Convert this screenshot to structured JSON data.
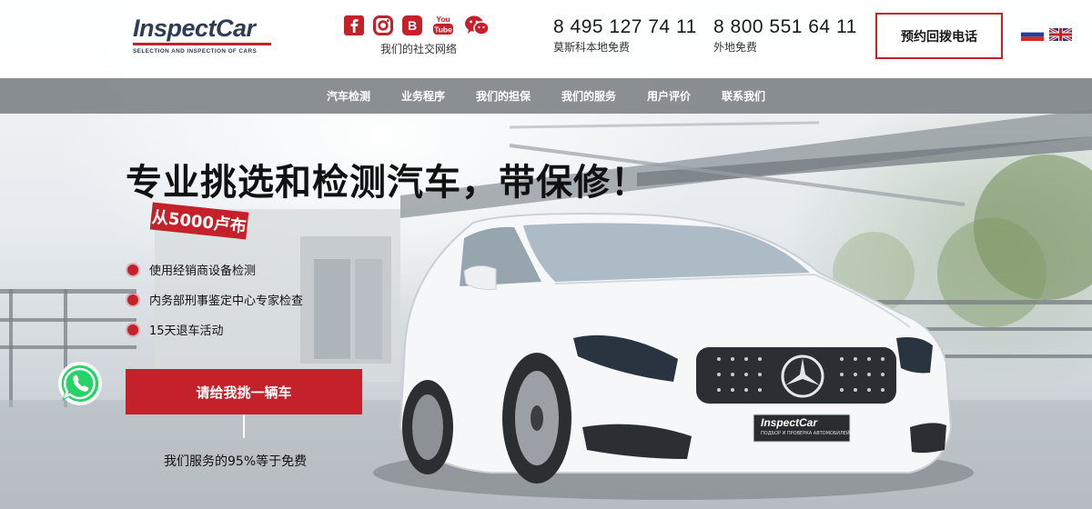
{
  "header": {
    "logo": {
      "name": "InspectCar",
      "tagline": "SELECTION AND INSPECTION OF CARS"
    },
    "social": {
      "icons": [
        "facebook-icon",
        "instagram-icon",
        "vk-icon",
        "youtube-icon",
        "wechat-icon"
      ],
      "youtube_label": "You Tube",
      "caption": "我们的社交网络"
    },
    "phones": [
      {
        "number": "8 495 127 74 11",
        "note": "莫斯科本地免费"
      },
      {
        "number": "8 800 551 64 11",
        "note": "外地免费"
      }
    ],
    "callback_label": "预约回拨电话",
    "languages": [
      "ru-flag-icon",
      "uk-flag-icon"
    ]
  },
  "nav": {
    "items": [
      "汽车检测",
      "业务程序",
      "我们的担保",
      "我们的服务",
      "用户评价",
      "联系我们"
    ]
  },
  "hero": {
    "title": "专业挑选和检测汽车，带保修！",
    "price": "从5000卢布",
    "features": [
      "使用经销商设备检测",
      "内务部刑事鉴定中心专家检查",
      "15天退车活动"
    ],
    "cta_label": "请给我挑一辆车",
    "note": "我们服务的95%等于免费"
  },
  "car": {
    "plate_text": "InspectCar",
    "plate_sub": "ПОДБОР И ПРОВЕРКА АВТОМОБИЛЕЙ"
  },
  "colors": {
    "accent": "#c4212b",
    "brand_text": "#2f3c55",
    "nav_bg": "#80858a",
    "whatsapp": "#25d366"
  }
}
